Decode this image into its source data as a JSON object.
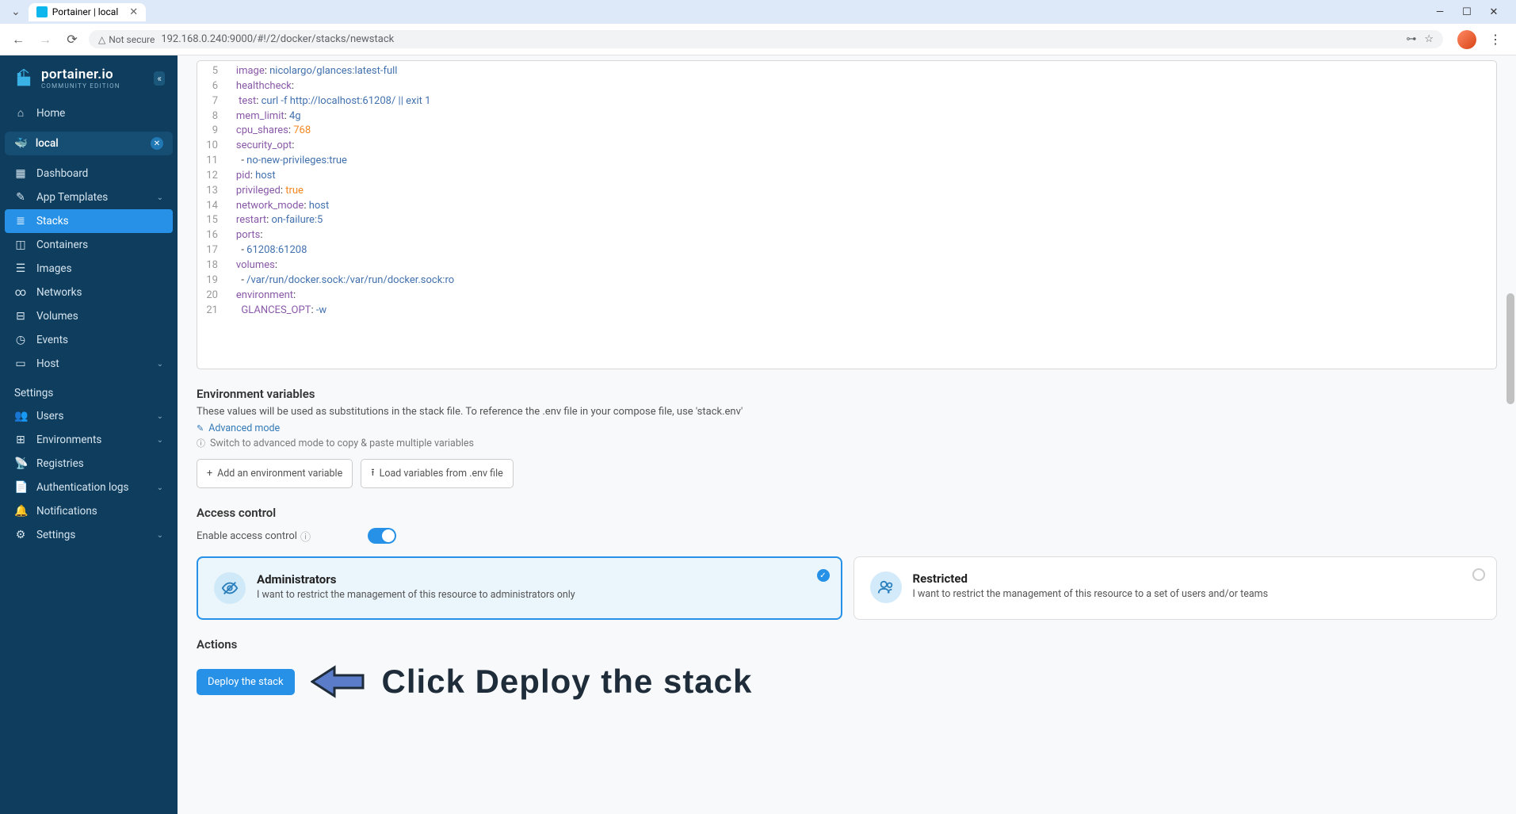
{
  "browser": {
    "tab_title": "Portainer | local",
    "security_label": "Not secure",
    "url": "192.168.0.240:9000/#!/2/docker/stacks/newstack"
  },
  "logo": {
    "brand": "portainer.io",
    "edition": "COMMUNITY EDITION"
  },
  "sidebar": {
    "home": "Home",
    "env_name": "local",
    "items": [
      "Dashboard",
      "App Templates",
      "Stacks",
      "Containers",
      "Images",
      "Networks",
      "Volumes",
      "Events",
      "Host"
    ],
    "settings_label": "Settings",
    "settings_items": [
      "Users",
      "Environments",
      "Registries",
      "Authentication logs",
      "Notifications",
      "Settings"
    ]
  },
  "editor_lines": [
    {
      "ln": 5,
      "tokens": [
        [
          "    ",
          ""
        ],
        [
          "image",
          "key"
        ],
        [
          ": ",
          "punc"
        ],
        [
          "nicolargo/glances:latest-full",
          "str"
        ]
      ]
    },
    {
      "ln": 6,
      "tokens": [
        [
          "    ",
          ""
        ],
        [
          "healthcheck",
          "key"
        ],
        [
          ":",
          "punc"
        ]
      ]
    },
    {
      "ln": 7,
      "tokens": [
        [
          "     ",
          ""
        ],
        [
          "test",
          "key"
        ],
        [
          ": ",
          "punc"
        ],
        [
          "curl -f http://localhost:61208/ || exit 1",
          "str"
        ]
      ]
    },
    {
      "ln": 8,
      "tokens": [
        [
          "    ",
          ""
        ],
        [
          "mem_limit",
          "key"
        ],
        [
          ": ",
          "punc"
        ],
        [
          "4g",
          "str"
        ]
      ]
    },
    {
      "ln": 9,
      "tokens": [
        [
          "    ",
          ""
        ],
        [
          "cpu_shares",
          "key"
        ],
        [
          ": ",
          "punc"
        ],
        [
          "768",
          "num"
        ]
      ]
    },
    {
      "ln": 10,
      "tokens": [
        [
          "    ",
          ""
        ],
        [
          "security_opt",
          "key"
        ],
        [
          ":",
          "punc"
        ]
      ]
    },
    {
      "ln": 11,
      "tokens": [
        [
          "      - ",
          "punc"
        ],
        [
          "no-new-privileges:true",
          "str"
        ]
      ]
    },
    {
      "ln": 12,
      "tokens": [
        [
          "    ",
          ""
        ],
        [
          "pid",
          "key"
        ],
        [
          ": ",
          "punc"
        ],
        [
          "host",
          "str"
        ]
      ]
    },
    {
      "ln": 13,
      "tokens": [
        [
          "    ",
          ""
        ],
        [
          "privileged",
          "key"
        ],
        [
          ": ",
          "punc"
        ],
        [
          "true",
          "num"
        ]
      ]
    },
    {
      "ln": 14,
      "tokens": [
        [
          "    ",
          ""
        ],
        [
          "network_mode",
          "key"
        ],
        [
          ": ",
          "punc"
        ],
        [
          "host",
          "str"
        ]
      ]
    },
    {
      "ln": 15,
      "tokens": [
        [
          "    ",
          ""
        ],
        [
          "restart",
          "key"
        ],
        [
          ": ",
          "punc"
        ],
        [
          "on-failure:5",
          "str"
        ]
      ]
    },
    {
      "ln": 16,
      "tokens": [
        [
          "    ",
          ""
        ],
        [
          "ports",
          "key"
        ],
        [
          ":",
          "punc"
        ]
      ]
    },
    {
      "ln": 17,
      "tokens": [
        [
          "      - ",
          "punc"
        ],
        [
          "61208:61208",
          "str"
        ]
      ]
    },
    {
      "ln": 18,
      "tokens": [
        [
          "    ",
          ""
        ],
        [
          "volumes",
          "key"
        ],
        [
          ":",
          "punc"
        ]
      ]
    },
    {
      "ln": 19,
      "tokens": [
        [
          "      - ",
          "punc"
        ],
        [
          "/var/run/docker.sock:/var/run/docker.sock:ro",
          "str"
        ]
      ]
    },
    {
      "ln": 20,
      "tokens": [
        [
          "    ",
          ""
        ],
        [
          "environment",
          "key"
        ],
        [
          ":",
          "punc"
        ]
      ]
    },
    {
      "ln": 21,
      "tokens": [
        [
          "      ",
          ""
        ],
        [
          "GLANCES_OPT",
          "key"
        ],
        [
          ": ",
          "punc"
        ],
        [
          "-w",
          "str"
        ]
      ]
    }
  ],
  "env_vars": {
    "title": "Environment variables",
    "desc": "These values will be used as substitutions in the stack file. To reference the .env file in your compose file, use 'stack.env'",
    "advanced_link": "Advanced mode",
    "hint": "Switch to advanced mode to copy & paste multiple variables",
    "add_btn": "Add an environment variable",
    "load_btn": "Load variables from .env file"
  },
  "access": {
    "title": "Access control",
    "toggle_label": "Enable access control",
    "admin_title": "Administrators",
    "admin_desc": "I want to restrict the management of this resource to administrators only",
    "restricted_title": "Restricted",
    "restricted_desc": "I want to restrict the management of this resource to a set of users and/or teams"
  },
  "actions": {
    "title": "Actions",
    "deploy_btn": "Deploy the stack"
  },
  "annotation": "Click Deploy the stack"
}
